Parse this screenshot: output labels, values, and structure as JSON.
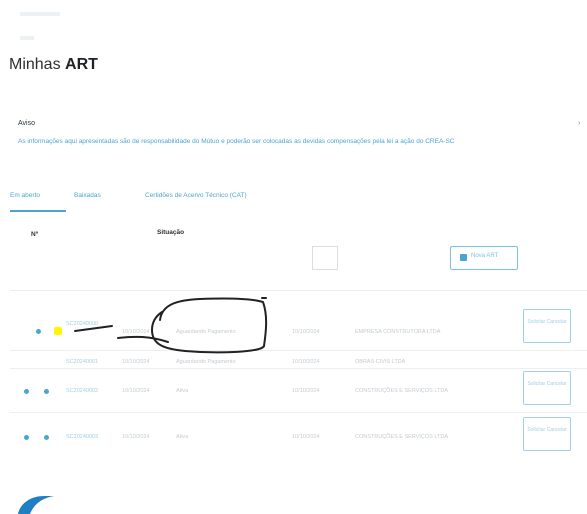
{
  "header": {
    "title_plain": "Minhas",
    "title_bold": "ART"
  },
  "notice": {
    "title": "Aviso",
    "text": "As informações aqui apresentadas são de responsabilidade do Mútuo e poderão ser colocadas as devidas compensações pela lei a ação do CREA-SC"
  },
  "tabs": [
    {
      "label": "Em aberto"
    },
    {
      "label": "Baixadas"
    },
    {
      "label": "Certidões de Acervo Técnico (CAT)"
    }
  ],
  "table": {
    "headers": {
      "number": "Nº",
      "situation": "Situação"
    },
    "new_button_label": "Nova ART",
    "rows": [
      {
        "number": "SC20240000",
        "date": "10/10/2024",
        "situation": "Aguardando Pagamento",
        "date2": "10/10/2024",
        "company": "EMPRESA CONSTRUTORA LTDA",
        "action": "Solicitar Cancelar",
        "flag": "highlighted"
      },
      {
        "number": "SC20240001",
        "date": "10/10/2024",
        "situation": "Aguardando Pagamento",
        "date2": "10/10/2024",
        "company": "OBRAS CIVIS LTDA",
        "action": "",
        "flag": ""
      },
      {
        "number": "SC20240002",
        "date": "10/10/2024",
        "situation": "Ativa",
        "date2": "10/10/2024",
        "company": "CONSTRUÇÕES E SERVIÇOS LTDA",
        "action": "Solicitar Cancelar",
        "flag": ""
      },
      {
        "number": "SC20240003",
        "date": "10/10/2024",
        "situation": "Ativa",
        "date2": "10/10/2024",
        "company": "CONSTRUÇÕES E SERVIÇOS LTDA",
        "action": "Solicitar Cancelar",
        "flag": ""
      }
    ]
  },
  "colors": {
    "accent": "#4aa6cf",
    "highlight": "#fff600",
    "ink": "#222222"
  }
}
